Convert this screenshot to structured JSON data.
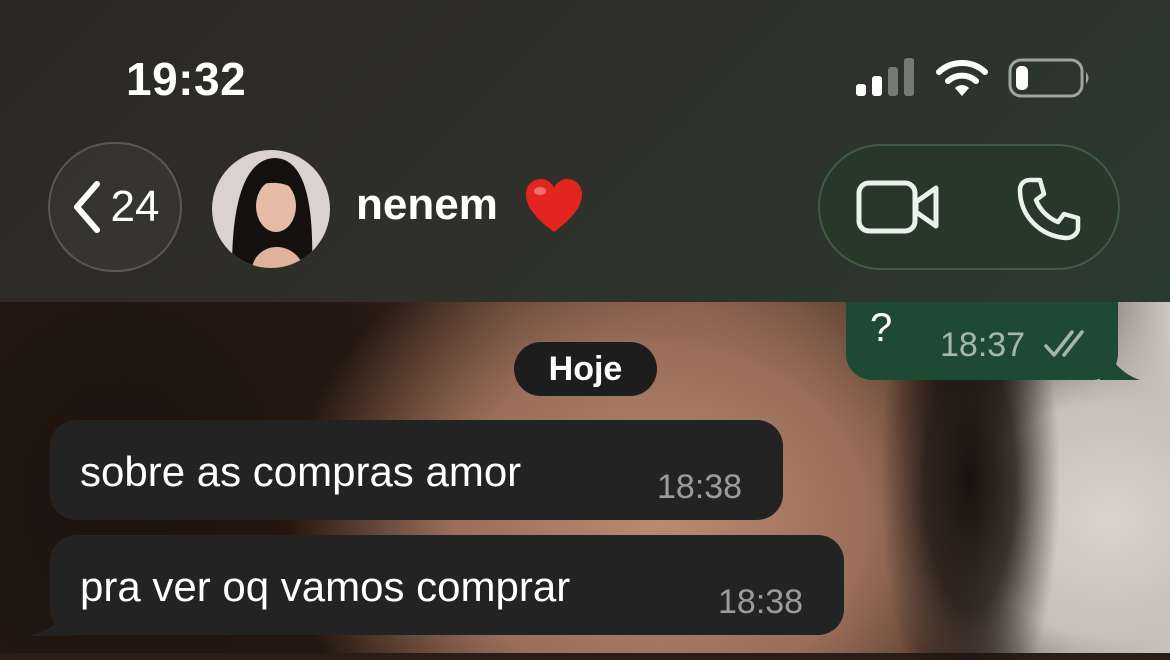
{
  "status_bar": {
    "time": "19:32",
    "signal_icon": "cellular-signal-icon",
    "wifi_icon": "wifi-icon",
    "battery_icon": "battery-low-icon"
  },
  "header": {
    "back_count": "24",
    "contact_name": "nenem",
    "contact_emoji": "red-heart-icon",
    "video_icon": "video-call-icon",
    "phone_icon": "phone-call-icon"
  },
  "chat": {
    "date_divider": "Hoje",
    "outgoing": [
      {
        "text": "?",
        "time": "18:37",
        "status": "read"
      }
    ],
    "incoming": [
      {
        "text": "sobre as compras amor",
        "time": "18:38"
      },
      {
        "text": "pra ver oq vamos comprar",
        "time": "18:38"
      }
    ]
  },
  "colors": {
    "outgoing_bubble": "#1e4a33",
    "incoming_bubble": "#232323",
    "call_pill": "#273829"
  }
}
